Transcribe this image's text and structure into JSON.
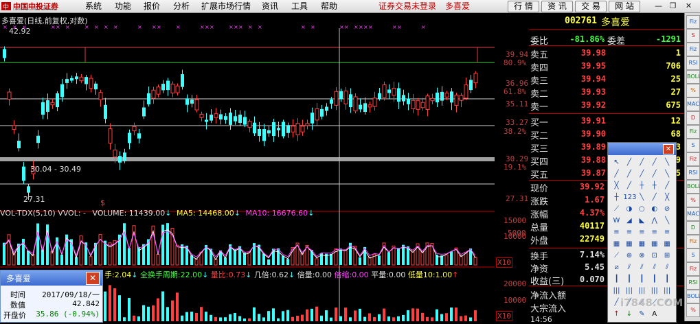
{
  "app": {
    "logo_text": "中国中投证券",
    "logo_sub": "CHINA INVESTMENT SECURITIES",
    "menu": [
      "系统",
      "功能",
      "报价",
      "分析",
      "扩展市场行情",
      "资讯",
      "工具",
      "帮助"
    ],
    "status_red": [
      "证券交易未登录",
      "多喜爱"
    ],
    "tabs": [
      "行 情",
      "资 讯",
      "交 易",
      "网 站"
    ],
    "window_buttons": [
      "minimize-icon",
      "restore-icon",
      "close-icon"
    ]
  },
  "chart": {
    "title": "多喜爱(日线,前复权,对数)",
    "high_marker": "42.92",
    "low_marker": "27.31",
    "range_label": "30.04 - 30.49",
    "dollar_marker": "$",
    "price_axis": [
      {
        "price": "39.94",
        "pct": "80.9%"
      },
      {
        "price": "36.96",
        "pct": "61.8%"
      },
      {
        "price": "35.11",
        "pct": ""
      },
      {
        "price": "33.27",
        "pct": "38.2%"
      },
      {
        "price": "30.29",
        "pct": "19.1%"
      },
      {
        "price": "27.31",
        "pct": ""
      }
    ],
    "vol_indicator": {
      "name": "VOL-TDX(5,10)",
      "vvol": "VVOL: -",
      "volume_label": "VOLUME:",
      "volume": "11439.00",
      "ma5_label": "MA5:",
      "ma5": "14468.00",
      "ma10_label": "MA10:",
      "ma10": "16676.60"
    },
    "vol_axis": [
      "15000",
      "10000",
      "5000",
      "X10"
    ],
    "bottom_indicator": {
      "items": [
        {
          "label": "手:",
          "value": "2.04"
        },
        {
          "label": "全换手周期:",
          "value": "22.00"
        },
        {
          "label": "量比:",
          "value": "0.73"
        },
        {
          "label": "几倍:",
          "value": "0.62"
        },
        {
          "label": "倍量:",
          "value": "0.00"
        },
        {
          "label": "倍缩:",
          "value": "0.00"
        },
        {
          "label": "平量:",
          "value": "0.00"
        },
        {
          "label": "低量10:",
          "value": "1.00"
        }
      ]
    },
    "bottom_axis": [
      "20000",
      "10000",
      "X10"
    ]
  },
  "popup": {
    "title": "多喜爱",
    "rows": [
      {
        "label": "时间",
        "value": "2017/09/18/一"
      },
      {
        "label": "数值",
        "value": "42.842"
      },
      {
        "label": "开盘价",
        "value": "35.86 (-0.94%)"
      }
    ]
  },
  "quote": {
    "code": "002761",
    "name": "多喜爱",
    "weibi_label": "委比",
    "weibi": "-81.86%",
    "weicha_label": "委差",
    "weicha": "-1291",
    "asks": [
      {
        "label": "卖五",
        "price": "39.98",
        "vol": "1"
      },
      {
        "label": "卖四",
        "price": "39.95",
        "vol": "706"
      },
      {
        "label": "卖三",
        "price": "39.94",
        "vol": "25"
      },
      {
        "label": "卖二",
        "price": "39.93",
        "vol": "27"
      },
      {
        "label": "卖一",
        "price": "39.92",
        "vol": "675"
      }
    ],
    "bids": [
      {
        "label": "买一",
        "price": "39.91",
        "vol": "12"
      },
      {
        "label": "买二",
        "price": "39.90",
        "vol": "68"
      },
      {
        "label": "买三",
        "price": "39.89",
        "vol": "3"
      },
      {
        "label": "买四",
        "price": "39.88",
        "vol": "9"
      },
      {
        "label": "买五",
        "price": "39.87",
        "vol": "5"
      }
    ],
    "stats": [
      {
        "label": "现价",
        "value": "39.92"
      },
      {
        "label": "涨跌",
        "value": "1.67"
      },
      {
        "label": "涨幅",
        "value": "4.37%"
      },
      {
        "label": "总量",
        "value": "40117"
      },
      {
        "label": "外盘",
        "value": "22749"
      }
    ],
    "stats2": [
      {
        "label": "换手",
        "value": "7.14%"
      },
      {
        "label": "净资",
        "value": "5.45"
      },
      {
        "label": "收益(三)",
        "value": "0.070"
      }
    ],
    "flows": [
      "净流入额",
      "大宗流入"
    ],
    "time_tick": "14:56"
  },
  "watermark": "i7848.COM",
  "right_toolbar": [
    "Fiz",
    "S",
    "Fiz",
    "RSI",
    "BOLL",
    "%",
    "MACD",
    "D"
  ],
  "colors": {
    "up": "#ff4040",
    "down": "#40ffff",
    "yellow": "#ffff40",
    "grid": "#c00000",
    "magenta": "#ff40ff"
  }
}
